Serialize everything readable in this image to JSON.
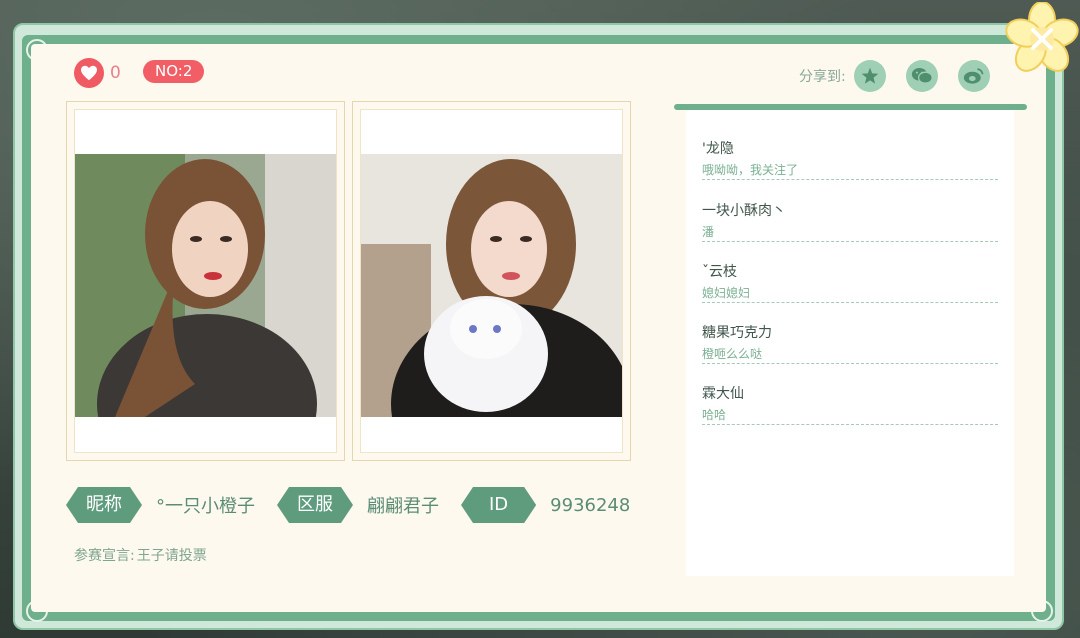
{
  "header": {
    "like_count": "0",
    "rank": "NO:2",
    "share_label": "分享到:"
  },
  "share_icons": [
    "qzone-icon",
    "wechat-icon",
    "weibo-icon"
  ],
  "photos": [
    {
      "alt": "contestant-photo-selfie"
    },
    {
      "alt": "contestant-photo-with-cat"
    }
  ],
  "profile": {
    "nickname_label": "昵称",
    "nickname": "°一只小橙子",
    "server_label": "区服",
    "server": "翩翩君子",
    "id_label": "ID",
    "id": "9936248",
    "slogan_label": "参赛宣言:",
    "slogan": "王子请投票"
  },
  "comments": [
    {
      "name": "'龙隐",
      "text": "哦呦呦，我关注了"
    },
    {
      "name": "一块小酥肉丶",
      "text": "潘"
    },
    {
      "name": "ˇ云枝",
      "text": "媳妇媳妇"
    },
    {
      "name": "糖果巧克力",
      "text": "橙咂么么哒"
    },
    {
      "name": "霖大仙",
      "text": "哈哈"
    }
  ],
  "colors": {
    "frame_green": "#6eb08c",
    "tag_green": "#5f9c7d",
    "badge_red": "#f15e66",
    "card_bg": "#fdf9ef"
  }
}
